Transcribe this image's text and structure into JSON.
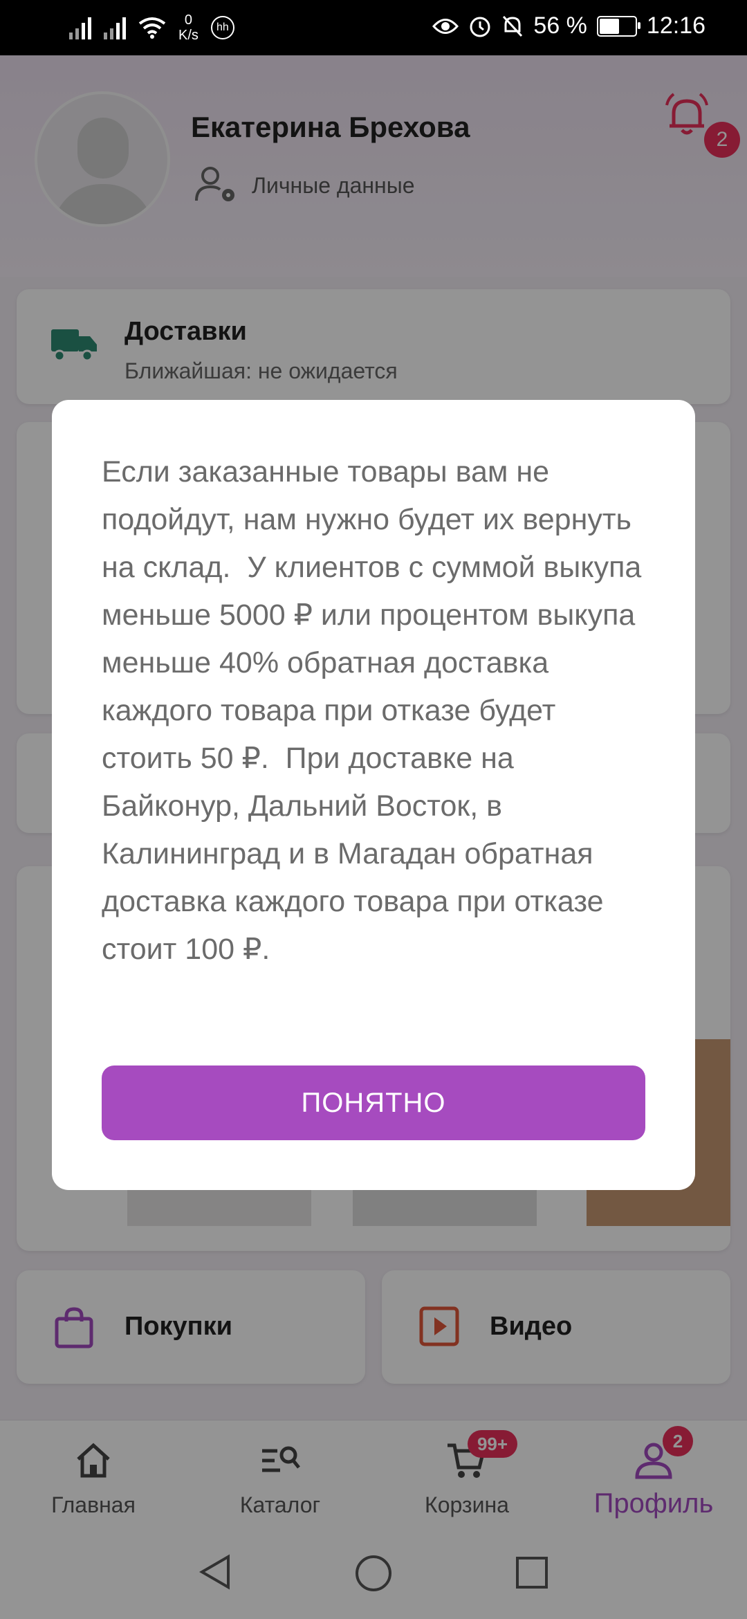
{
  "status_bar": {
    "speed_value": "0",
    "speed_unit": "K/s",
    "hd_label": "hh",
    "battery_percent": "56 %",
    "battery_level": 0.56,
    "time": "12:16"
  },
  "profile": {
    "name": "Екатерина Брехова",
    "personal_data_label": "Личные данные",
    "notifications_count": "2"
  },
  "delivery": {
    "title": "Доставки",
    "subtitle": "Ближайшая: не ожидается"
  },
  "tiles": {
    "purchases_label": "Покупки",
    "video_label": "Видео"
  },
  "dialog": {
    "text": "Если заказанные товары вам не подойдут, нам нужно будет их вернуть на склад.  У клиентов с суммой выкупа меньше 5000 ₽ или процентом выкупа меньше 40% обратная доставка каждого товара при отказе будет стоить 50 ₽.  При доставке на Байконур, Дальний Восток, в Калининград и в Магадан обратная доставка каждого товара при отказе стоит 100 ₽.",
    "ok_label": "ПОНЯТНО"
  },
  "bottom_nav": {
    "home_label": "Главная",
    "catalog_label": "Каталог",
    "cart_label": "Корзина",
    "cart_badge": "99+",
    "profile_label": "Профиль",
    "profile_badge": "2"
  },
  "colors": {
    "accent": "#a64bbf",
    "badge": "#e8305a",
    "delivery_icon": "#2d8a73"
  }
}
